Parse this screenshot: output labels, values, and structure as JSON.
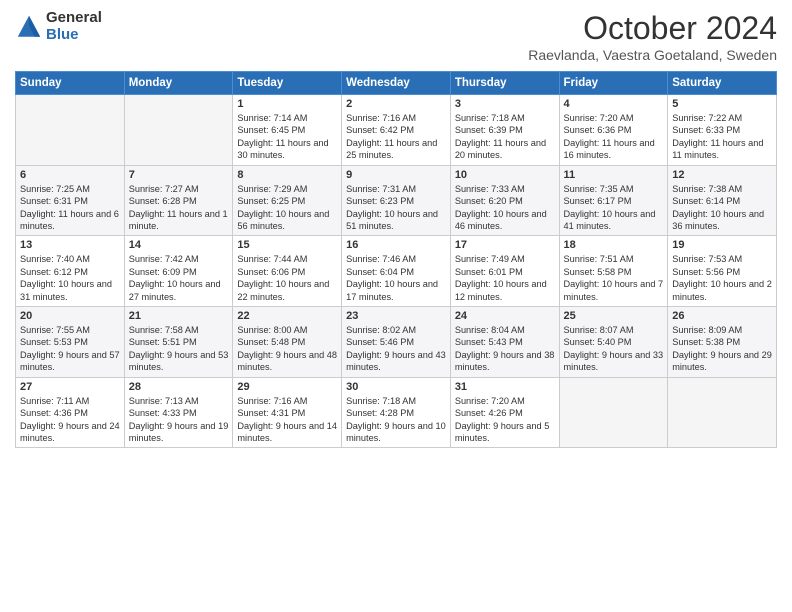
{
  "logo": {
    "general": "General",
    "blue": "Blue"
  },
  "title": "October 2024",
  "location": "Raevlanda, Vaestra Goetaland, Sweden",
  "days_of_week": [
    "Sunday",
    "Monday",
    "Tuesday",
    "Wednesday",
    "Thursday",
    "Friday",
    "Saturday"
  ],
  "weeks": [
    [
      {
        "day": "",
        "content": ""
      },
      {
        "day": "",
        "content": ""
      },
      {
        "day": "1",
        "content": "Sunrise: 7:14 AM\nSunset: 6:45 PM\nDaylight: 11 hours and 30 minutes."
      },
      {
        "day": "2",
        "content": "Sunrise: 7:16 AM\nSunset: 6:42 PM\nDaylight: 11 hours and 25 minutes."
      },
      {
        "day": "3",
        "content": "Sunrise: 7:18 AM\nSunset: 6:39 PM\nDaylight: 11 hours and 20 minutes."
      },
      {
        "day": "4",
        "content": "Sunrise: 7:20 AM\nSunset: 6:36 PM\nDaylight: 11 hours and 16 minutes."
      },
      {
        "day": "5",
        "content": "Sunrise: 7:22 AM\nSunset: 6:33 PM\nDaylight: 11 hours and 11 minutes."
      }
    ],
    [
      {
        "day": "6",
        "content": "Sunrise: 7:25 AM\nSunset: 6:31 PM\nDaylight: 11 hours and 6 minutes."
      },
      {
        "day": "7",
        "content": "Sunrise: 7:27 AM\nSunset: 6:28 PM\nDaylight: 11 hours and 1 minute."
      },
      {
        "day": "8",
        "content": "Sunrise: 7:29 AM\nSunset: 6:25 PM\nDaylight: 10 hours and 56 minutes."
      },
      {
        "day": "9",
        "content": "Sunrise: 7:31 AM\nSunset: 6:23 PM\nDaylight: 10 hours and 51 minutes."
      },
      {
        "day": "10",
        "content": "Sunrise: 7:33 AM\nSunset: 6:20 PM\nDaylight: 10 hours and 46 minutes."
      },
      {
        "day": "11",
        "content": "Sunrise: 7:35 AM\nSunset: 6:17 PM\nDaylight: 10 hours and 41 minutes."
      },
      {
        "day": "12",
        "content": "Sunrise: 7:38 AM\nSunset: 6:14 PM\nDaylight: 10 hours and 36 minutes."
      }
    ],
    [
      {
        "day": "13",
        "content": "Sunrise: 7:40 AM\nSunset: 6:12 PM\nDaylight: 10 hours and 31 minutes."
      },
      {
        "day": "14",
        "content": "Sunrise: 7:42 AM\nSunset: 6:09 PM\nDaylight: 10 hours and 27 minutes."
      },
      {
        "day": "15",
        "content": "Sunrise: 7:44 AM\nSunset: 6:06 PM\nDaylight: 10 hours and 22 minutes."
      },
      {
        "day": "16",
        "content": "Sunrise: 7:46 AM\nSunset: 6:04 PM\nDaylight: 10 hours and 17 minutes."
      },
      {
        "day": "17",
        "content": "Sunrise: 7:49 AM\nSunset: 6:01 PM\nDaylight: 10 hours and 12 minutes."
      },
      {
        "day": "18",
        "content": "Sunrise: 7:51 AM\nSunset: 5:58 PM\nDaylight: 10 hours and 7 minutes."
      },
      {
        "day": "19",
        "content": "Sunrise: 7:53 AM\nSunset: 5:56 PM\nDaylight: 10 hours and 2 minutes."
      }
    ],
    [
      {
        "day": "20",
        "content": "Sunrise: 7:55 AM\nSunset: 5:53 PM\nDaylight: 9 hours and 57 minutes."
      },
      {
        "day": "21",
        "content": "Sunrise: 7:58 AM\nSunset: 5:51 PM\nDaylight: 9 hours and 53 minutes."
      },
      {
        "day": "22",
        "content": "Sunrise: 8:00 AM\nSunset: 5:48 PM\nDaylight: 9 hours and 48 minutes."
      },
      {
        "day": "23",
        "content": "Sunrise: 8:02 AM\nSunset: 5:46 PM\nDaylight: 9 hours and 43 minutes."
      },
      {
        "day": "24",
        "content": "Sunrise: 8:04 AM\nSunset: 5:43 PM\nDaylight: 9 hours and 38 minutes."
      },
      {
        "day": "25",
        "content": "Sunrise: 8:07 AM\nSunset: 5:40 PM\nDaylight: 9 hours and 33 minutes."
      },
      {
        "day": "26",
        "content": "Sunrise: 8:09 AM\nSunset: 5:38 PM\nDaylight: 9 hours and 29 minutes."
      }
    ],
    [
      {
        "day": "27",
        "content": "Sunrise: 7:11 AM\nSunset: 4:36 PM\nDaylight: 9 hours and 24 minutes."
      },
      {
        "day": "28",
        "content": "Sunrise: 7:13 AM\nSunset: 4:33 PM\nDaylight: 9 hours and 19 minutes."
      },
      {
        "day": "29",
        "content": "Sunrise: 7:16 AM\nSunset: 4:31 PM\nDaylight: 9 hours and 14 minutes."
      },
      {
        "day": "30",
        "content": "Sunrise: 7:18 AM\nSunset: 4:28 PM\nDaylight: 9 hours and 10 minutes."
      },
      {
        "day": "31",
        "content": "Sunrise: 7:20 AM\nSunset: 4:26 PM\nDaylight: 9 hours and 5 minutes."
      },
      {
        "day": "",
        "content": ""
      },
      {
        "day": "",
        "content": ""
      }
    ]
  ]
}
